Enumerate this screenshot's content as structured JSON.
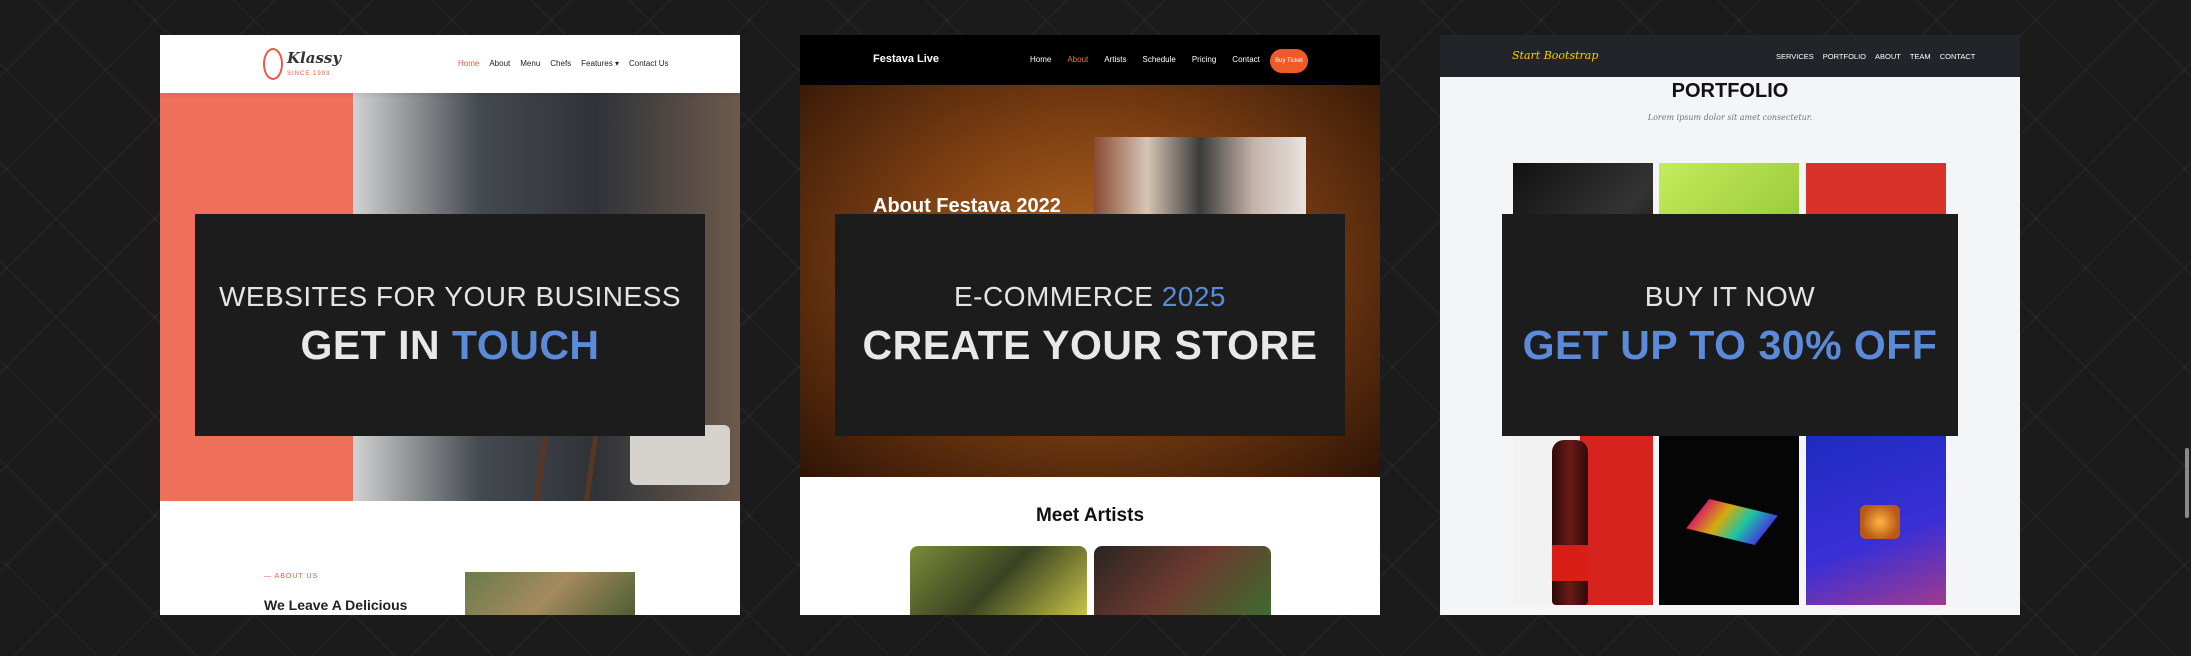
{
  "cards": [
    {
      "overlay_top": "WEBSITES FOR YOUR BUSINESS",
      "overlay_main_a": "GET IN ",
      "overlay_main_b": "TOUCH",
      "preview": {
        "logo": "Klassy",
        "logo_sub": "SINCE 1993",
        "nav": [
          "Home",
          "About",
          "Menu",
          "Chefs",
          "Features ▾",
          "Contact Us"
        ],
        "section_label": "— ABOUT US",
        "section_heading": "We Leave A Delicious"
      }
    },
    {
      "overlay_top_a": "E-COMMERCE ",
      "overlay_top_b": "2025",
      "overlay_main": "CREATE YOUR STORE",
      "preview": {
        "brand": "Festava Live",
        "nav": [
          "Home",
          "About",
          "Artists",
          "Schedule",
          "Pricing",
          "Contact"
        ],
        "cta": "Buy Ticket",
        "hero_title": "About Festava 2022",
        "section_title": "Meet Artists"
      }
    },
    {
      "overlay_top": "BUY IT NOW",
      "overlay_main": "GET UP TO 30% OFF",
      "preview": {
        "brand": "Start Bootstrap",
        "nav": [
          "SERVICES",
          "PORTFOLIO",
          "ABOUT",
          "TEAM",
          "CONTACT"
        ],
        "section_title": "PORTFOLIO",
        "section_sub": "Lorem ipsum dolor sit amet consectetur."
      }
    }
  ],
  "colors": {
    "accent_blue": "#5b8ad8",
    "overlay_bg": "#1c1c1c",
    "page_bg": "#1b1b1b"
  }
}
